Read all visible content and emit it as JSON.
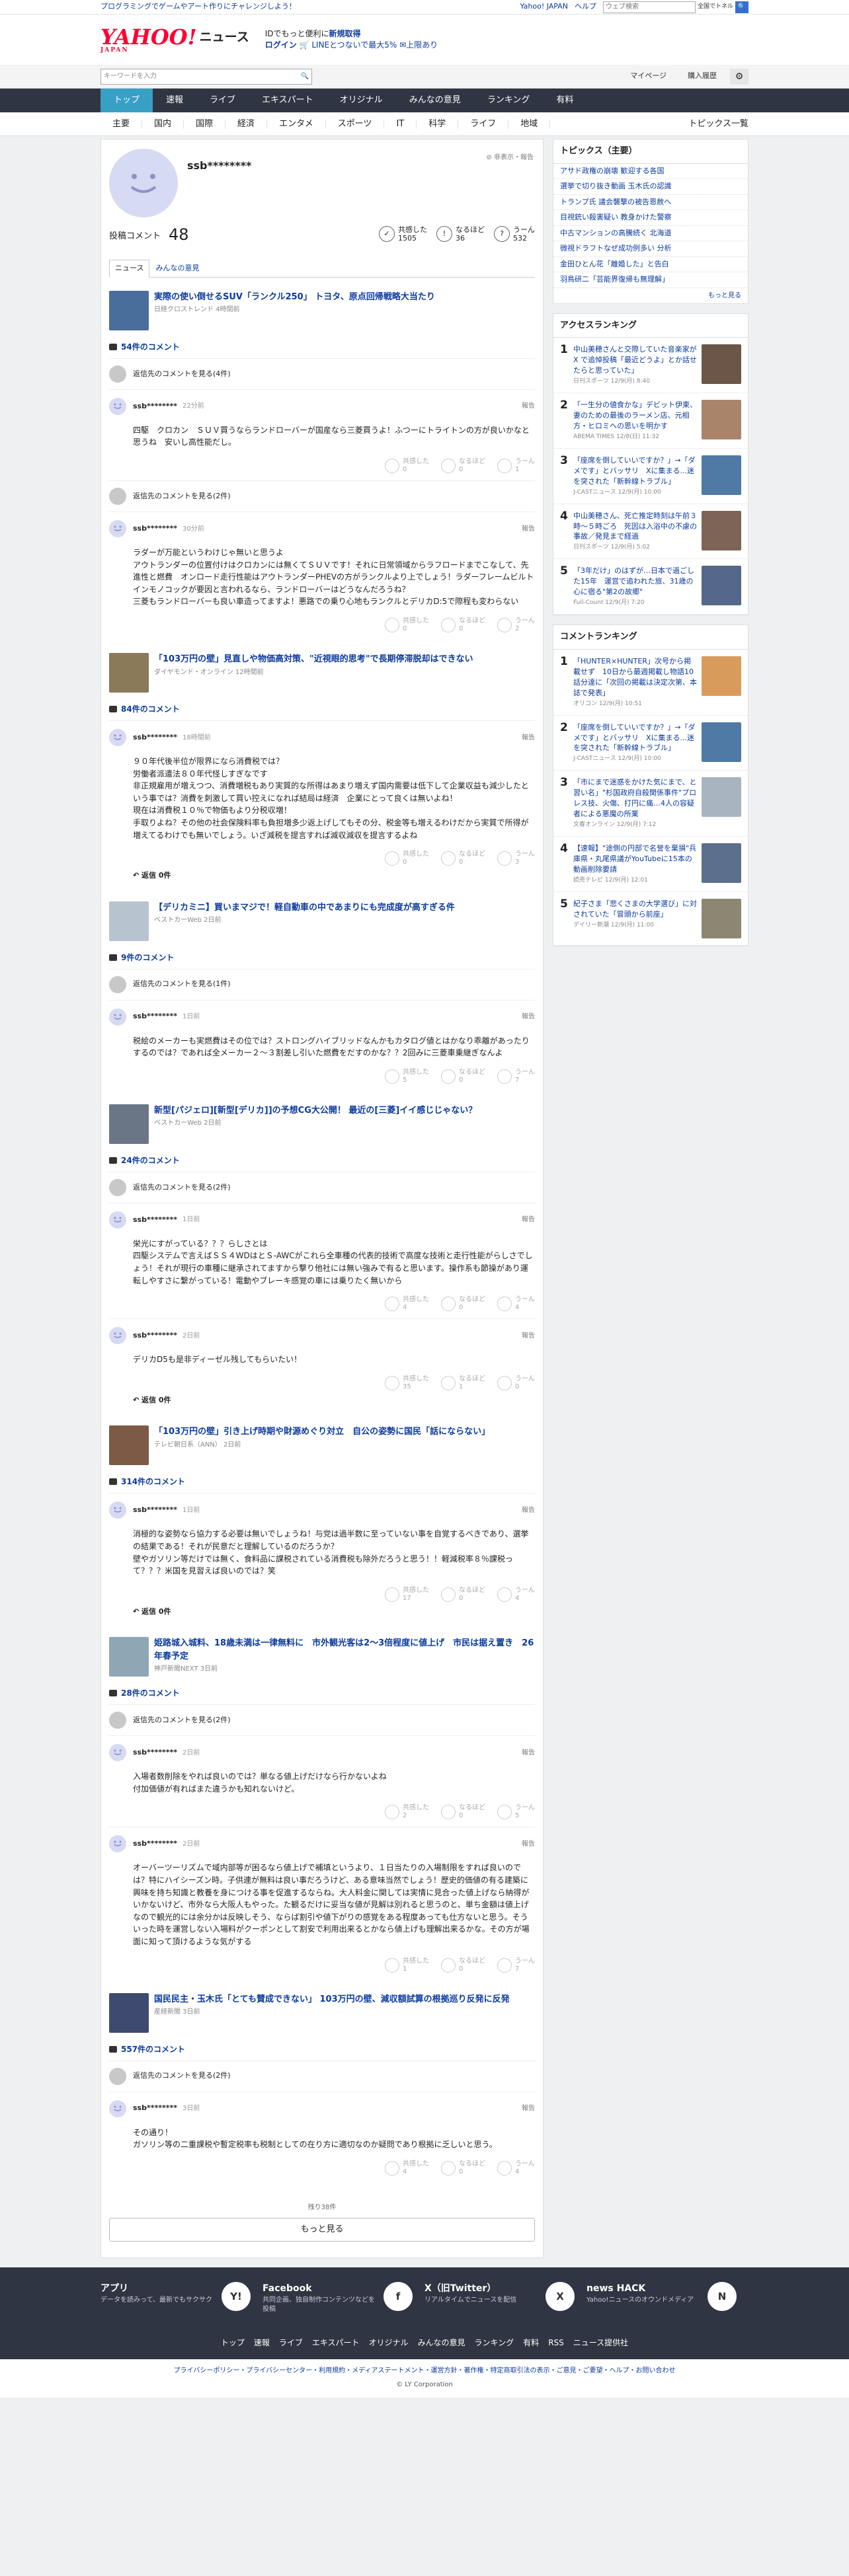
{
  "topbar": {
    "promo": "プログラミングでゲームやアート作りにチャレンジしよう！",
    "links": [
      "Yahoo! JAPAN",
      "ヘルプ"
    ],
    "search_placeholder": "ウェブ検索",
    "search_scope": "全国でトネル"
  },
  "header": {
    "logo_main": "YAHOO!",
    "logo_sub": "JAPAN",
    "service": "ニュース",
    "promo_line1": "IDでもっと便利に",
    "promo_line1b": "新規取得",
    "promo_login": "ログイン",
    "promo_line2": "🛒 LINEとつないで最大5% ✉上限あり"
  },
  "search": {
    "placeholder": "キーワードを入力",
    "mypage": "マイページ",
    "history": "購入履歴"
  },
  "gnav": {
    "items": [
      "トップ",
      "速報",
      "ライブ",
      "エキスパート",
      "オリジナル",
      "みんなの意見",
      "ランキング",
      "有料"
    ]
  },
  "subnav": {
    "items": [
      "主要",
      "国内",
      "国際",
      "経済",
      "エンタメ",
      "スポーツ",
      "IT",
      "科学",
      "ライフ",
      "地域"
    ],
    "topics_list": "トピックス一覧"
  },
  "profile": {
    "username": "ssb********",
    "report": "非表示・報告",
    "posted_label": "投稿コメント",
    "posted_count": "48",
    "stats": [
      {
        "label": "共感した",
        "value": "1505"
      },
      {
        "label": "なるほど",
        "value": "36"
      },
      {
        "label": "うーん",
        "value": "532"
      }
    ],
    "tabs": [
      "ニュース",
      "みんなの意見"
    ]
  },
  "articles": [
    {
      "title": "実際の使い倒せるSUV「ランクル250」 トヨタ、原点回帰戦略大当たり",
      "source": "日経クロストレンド 4時間前",
      "thumb": "#4a6e9c",
      "count": "54件のコメント",
      "items": [
        {
          "type": "other",
          "text": "返信先のコメントを見る(4件)"
        },
        {
          "type": "comment",
          "user": "ssb********",
          "time": "22分前",
          "report": "報告",
          "text": "四駆　クロカン　ＳＵＶ買うならランドローバーが国産なら三菱買うよ！ふつーにトライトンの方が良いかなと思うね　安いし高性能だし。",
          "r1": "0",
          "r2": "0",
          "r3": "1"
        },
        {
          "type": "other",
          "text": "返信先のコメントを見る(2件)"
        },
        {
          "type": "comment",
          "user": "ssb********",
          "time": "30分前",
          "report": "報告",
          "text": "ラダーが万能というわけじゃ無いと思うよ\nアウトランダーの位置付けはクロカンには無くてＳＵＶです！それに日常領域からラフロードまでこなして、先進性と燃費　オンロード走行性能はアウトランダーPHEVの方がランクルより上でしょう！ラダーフレームビルトインモノコックが要因と言われるなら、ランドローバーはどうなんだろうね？\n三菱もランドローバーも良い車造ってますよ！悪路での乗り心地もランクルとデリカD:5で際程も変わらない",
          "r1": "0",
          "r2": "0",
          "r3": "2"
        }
      ]
    },
    {
      "title": "「103万円の壁」見直しや物価高対策、\"近視眼的思考\"で長期停滞脱却はできない",
      "source": "ダイヤモンド・オンライン 12時間前",
      "thumb": "#8a7a5a",
      "count": "84件のコメント",
      "items": [
        {
          "type": "comment",
          "user": "ssb********",
          "time": "18時間前",
          "report": "報告",
          "text": "９０年代後半位が限界になら消費税では？\n労働者派遣法８０年代怪しすぎなです\n非正規雇用が増えつつ、消費増税もあり実質的な所得はあまり増えず国内需要は低下して企業収益も減少したという事では？消費を刺激して買い控えになれば結局は経済　企業にとって良くは無いよね！\n現在は消費税１０％で物価もより分税収増！\n手取りよね？その他の社会保険料率も負担増多少返上げしてもその分、税金等も増えるわけだから実質で所得が増えてるわけでも無いでしょう。いざ減税を提言すれば減収減収を提言するよね",
          "r1": "0",
          "r2": "0",
          "r3": "3",
          "replies": "返信 0件"
        }
      ]
    },
    {
      "title": "【デリカミニ】買いまマジで！軽自動車の中であまりにも完成度が高すぎる件",
      "source": "ベストカーWeb 2日前",
      "thumb": "#b7c3cf",
      "count": "9件のコメント",
      "items": [
        {
          "type": "other",
          "text": "返信先のコメントを見る(1件)"
        },
        {
          "type": "comment",
          "user": "ssb********",
          "time": "1日前",
          "report": "報告",
          "text": "税絵のメーカーも実燃費はその位では？ストロングハイブリッドなんかもカタログ値とはかなり乖離があったりするのでは？であれば全メーカー２～３割差し引いた燃費をだすのかな？？2回みに三菱車乗継ぎなんよ",
          "r1": "5",
          "r2": "0",
          "r3": "7"
        }
      ]
    },
    {
      "title": "新型[パジェロ][新型[デリカ]]の予想CG大公開！ 最近の[三菱]イイ感じじゃない？",
      "source": "ベストカーWeb 2日前",
      "thumb": "#6a7686",
      "count": "24件のコメント",
      "items": [
        {
          "type": "other",
          "text": "返信先のコメントを見る(2件)"
        },
        {
          "type": "comment",
          "user": "ssb********",
          "time": "1日前",
          "report": "報告",
          "text": "栄光にすがっている？？？らしさとは\n四駆システムで言えばＳＳ４WDはとＳ-AWCがこれら全車種の代表的技術で高度な技術と走行性能がらしさでしょう！それが現行の車種に継承されてますから撃り他社には無い強みで有ると思います。操作系も節操があり運転しやすさに繋がっている！電動やブレーキ感覚の車には乗りたく無いから",
          "r1": "4",
          "r2": "0",
          "r3": "4"
        },
        {
          "type": "comment",
          "user": "ssb********",
          "time": "2日前",
          "report": "報告",
          "text": "デリカD5も是非ディーゼル残してもらいたい！",
          "r1": "35",
          "r2": "1",
          "r3": "0",
          "replies": "返信 0件"
        }
      ]
    },
    {
      "title": "「103万円の壁」引き上げ時期や財源めぐり対立　自公の姿勢に国民「話にならない」",
      "source": "テレビ朝日系（ANN） 2日前",
      "thumb": "#7c5a46",
      "count": "314件のコメント",
      "items": [
        {
          "type": "comment",
          "user": "ssb********",
          "time": "1日前",
          "report": "報告",
          "text": "消極的な姿勢なら協力する必要は無いでしょうね！与党は過半数に至っていない事を自覚するべきであり、選挙の結果である！それが民意だと理解しているのだろうか？\n壁やガソリン等だけでは無く、食料品に課税されている消費税も除外だろうと思う！！軽減税率８％課税って？？？米国を見習えば良いのでは？笑",
          "r1": "17",
          "r2": "0",
          "r3": "4",
          "replies": "返信 0件"
        }
      ]
    },
    {
      "title": "姫路城入城料、18歳未満は一律無料に　市外観光客は2～3倍程度に値上げ　市民は据え置き　26年春予定",
      "source": "神戸新聞NEXT 3日前",
      "thumb": "#8fa6b4",
      "count": "28件のコメント",
      "items": [
        {
          "type": "other",
          "text": "返信先のコメントを見る(2件)"
        },
        {
          "type": "comment",
          "user": "ssb********",
          "time": "2日前",
          "report": "報告",
          "text": "入場者数削除をやれば良いのでは？単なる値上げだけなら行かないよね\n付加価値が有ればまた違うかも知れないけど。",
          "r1": "2",
          "r2": "0",
          "r3": "5"
        },
        {
          "type": "comment",
          "user": "ssb********",
          "time": "2日前",
          "report": "報告",
          "text": "オーバーツーリズムで域内部等が困るなら値上げで補填というより、１日当たりの入場制限をすれば良いのでは？特にハイシーズン時。子供連が無料は良い事だろうけど、ある意味当然でしょう！歴史的価値の有る建築に興味を持ち知識と教養を身につける事を促進するならね。大人料金に関しては実情に見合った値上げなら納得がいかないけど、市外なら大阪人もやった。た観るだけに妥当な値が見解は別れると思うのと、単ち金額は値上げなので観光的には余分かは反映しそう、ならば割引や値下がりの感覚をある程度あっても仕方ないと思う。そういった時を運営しない入場料がクーポンとして割安で利用出来るとかなら値上げも理解出来るかな。その方が場面に知って頂けるような気がする",
          "r1": "1",
          "r2": "0",
          "r3": "7"
        }
      ]
    },
    {
      "title": "国民民主・玉木氏「とても賛成できない」 103万円の壁、減収額試算の根拠巡り反発に反発",
      "source": "産経新聞 3日前",
      "thumb": "#3e4a70",
      "count": "557件のコメント",
      "items": [
        {
          "type": "other",
          "text": "返信先のコメントを見る(2件)"
        },
        {
          "type": "comment",
          "user": "ssb********",
          "time": "3日前",
          "report": "報告",
          "text": "その通り！\nガソリン等の二重課税や暫定税率も税制としての在り方に適切なのか疑問であり根拠に乏しいと思う。",
          "r1": "4",
          "r2": "0",
          "r3": "4"
        }
      ]
    }
  ],
  "more": {
    "remaining": "残り38件",
    "button": "もっと見る"
  },
  "sidebar": {
    "topics_title": "トピックス（主要）",
    "topics": [
      "アサド政権の崩壊 歓迎する各国",
      "選挙で切り抜き動画 玉木氏の認識",
      "トランプ氏 議会襲撃の被告恩赦へ",
      "目視銃い殺害疑い 教身かけた警察",
      "中古マンションの高騰続く 北海道",
      "微視ドラフトなぜ成功例多い 分析",
      "金田ひとん花「離婚した」と告白",
      "羽鳥研二「芸能界復帰も無理解」"
    ],
    "topics_more": "もっと見る",
    "access_title": "アクセスランキング",
    "access": [
      {
        "no": "1",
        "title": "中山美穂さんと交際していた音楽家がX で追悼投稿「最近どうよ」とか話せたらと思っていた」",
        "source": "日刊スポーツ 12/9(月) 8:40",
        "img": "#6b5648"
      },
      {
        "no": "2",
        "title": "「一生分の値食かな」デビット伊東、妻のための最後のラーメン店、元相方・ヒロミへの思いを明かす",
        "source": "ABEMA TIMES 12/8(日) 11:32",
        "img": "#a9836a"
      },
      {
        "no": "3",
        "title": "「座席を倒していいですか？」→「ダメです」とバッサリ　Xに集まる...迷を突された「新幹線トラブル」",
        "source": "J-CASTニュース 12/9(月) 10:00",
        "img": "#4f7aa6"
      },
      {
        "no": "4",
        "title": "中山美穂さん、死亡推定時刻は午前３時～５時ごろ　死因は入浴中の不慮の事故／発見まで経過",
        "source": "日刊スポーツ 12/9(月) 5:02",
        "img": "#7e6456"
      },
      {
        "no": "5",
        "title": "「3年だけ」のはずが…日本で過ごした15年　運営で追われた旅、31歳の心に宿る\"第2の故郷\"",
        "source": "Full-Count 12/9(月) 7:20",
        "img": "#55678a"
      }
    ],
    "comment_title": "コメントランキング",
    "comment": [
      {
        "no": "1",
        "title": "「HUNTER×HUNTER」次号から掲載せず　10日から最週掲載し物語10話分達に「次回の掲載は決定次第、本誌で発表」",
        "source": "オリコン 12/9(月) 10:51",
        "img": "#d99b5c"
      },
      {
        "no": "2",
        "title": "「座席を倒していいですか？」→「ダメです」とバッサリ　Xに集まる...迷を突された「新幹線トラブル」",
        "source": "J-CASTニュース 12/9(月) 10:00",
        "img": "#4f7aa6"
      },
      {
        "no": "3",
        "title": "「市にまで迷惑をかけた気にまで、と習い名」\"杉国政府自殺関係事件\"プロレス技、火傷、打円に痛…4人の容疑者による悪魔の所業",
        "source": "文春オンライン 12/9(月) 7:12",
        "img": "#a8b4c0"
      },
      {
        "no": "4",
        "title": "【速報】\"途側の円部で名誉を棄損\"兵庫県・丸尾県議がYouTubeに15本の動画削除要請",
        "source": "読売テレビ 12/9(月) 12:01",
        "img": "#5c6f8c"
      },
      {
        "no": "5",
        "title": "紀子さま「悲くさまの大学選び」に対されていた「冒頭から前座」",
        "source": "デイリー新潮 12/9(月) 11:00",
        "img": "#8d8672"
      }
    ]
  },
  "footer": {
    "cards": [
      {
        "title": "アプリ",
        "desc": "データを読みって、最新でもサクサク",
        "icon": "Y!"
      },
      {
        "title": "Facebook",
        "desc": "共同企画、独自制作コンテンツなどを投稿",
        "icon": "f"
      },
      {
        "title": "X（旧Twitter）",
        "desc": "リアルタイムでニュースを配信",
        "icon": "X"
      },
      {
        "title": "news HACK",
        "desc": "Yahoo!ニュースのオウンドメディア",
        "icon": "N"
      }
    ],
    "links": [
      "トップ",
      "速報",
      "ライブ",
      "エキスパート",
      "オリジナル",
      "みんなの意見",
      "ランキング",
      "有料",
      "RSS",
      "ニュース提供社"
    ],
    "legal": "プライバシーポリシー・プライバシーセンター・利用規約・メディアステートメント・運営方針・著作権・特定商取引法の表示・ご意見・ご要望・ヘルプ・お問い合わせ",
    "copyright": "© LY Corporation"
  }
}
